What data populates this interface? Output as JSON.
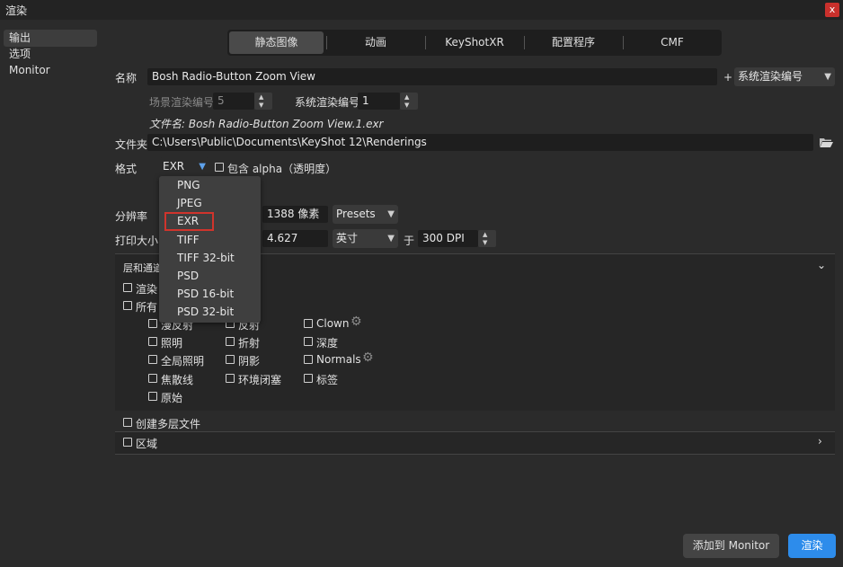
{
  "window": {
    "title": "渲染",
    "close_label": "x"
  },
  "sidebar": {
    "items": [
      {
        "label": "输出",
        "active": true
      },
      {
        "label": "选项"
      },
      {
        "label": "Monitor"
      }
    ]
  },
  "tabs": [
    {
      "label": "静态图像",
      "active": true
    },
    {
      "label": "动画"
    },
    {
      "label": "KeyShotXR"
    },
    {
      "label": "配置程序"
    },
    {
      "label": "CMF"
    }
  ],
  "name_row": {
    "label": "名称",
    "value": "Bosh Radio-Button Zoom View",
    "plus": "+",
    "dropdown": "系统渲染编号"
  },
  "numbering": {
    "scene_label": "场景渲染编号",
    "scene_value": "5",
    "system_label": "系统渲染编号",
    "system_value": "1"
  },
  "filename": "文件名: Bosh Radio-Button Zoom View.1.exr",
  "folder": {
    "label": "文件夹",
    "value": "C:\\Users\\Public\\Documents\\KeyShot 12\\Renderings",
    "icon": "folder-open-icon"
  },
  "format": {
    "label": "格式",
    "selected": "EXR",
    "alpha_label": "包含 alpha（透明度）"
  },
  "format_options": [
    "PNG",
    "JPEG",
    "EXR",
    "TIFF",
    "TIFF 32-bit",
    "PSD",
    "PSD 16-bit",
    "PSD 32-bit"
  ],
  "resolution": {
    "label": "分辨率",
    "value": "1388 像素",
    "presets": "Presets"
  },
  "print_size": {
    "label": "打印大小",
    "value": "4.627",
    "unit": "英寸",
    "at": "于",
    "dpi": "300 DPI"
  },
  "layers": {
    "title": "层和通道",
    "partial1": "渲染",
    "partial2": "所有",
    "col1": [
      "漫反射",
      "照明",
      "全局照明",
      "焦散线",
      "原始"
    ],
    "col2": [
      "反射",
      "折射",
      "阴影",
      "环境闭塞"
    ],
    "col3": [
      "Clown",
      "深度",
      "Normals",
      "标签"
    ],
    "multilayer": "创建多层文件"
  },
  "region": {
    "label": "区域"
  },
  "buttons": {
    "add_monitor": "添加到 Monitor",
    "render": "渲染"
  },
  "colors": {
    "accent": "#2d8ceb",
    "background": "#2b2b2b",
    "field": "#1e1e1e",
    "highlight": "#d0342c"
  }
}
